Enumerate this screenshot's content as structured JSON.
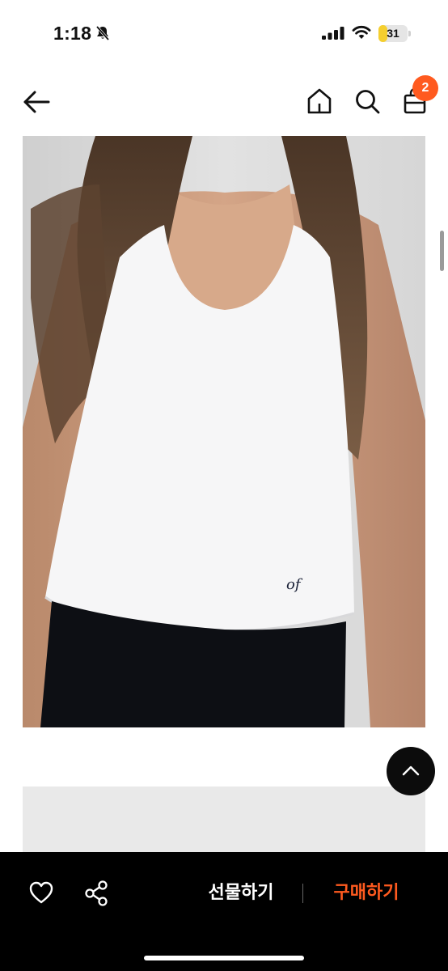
{
  "status_bar": {
    "time": "1:18",
    "battery_level": "31",
    "battery_fraction": 0.31,
    "icons": [
      "bell-slash-icon",
      "cellular-signal-icon",
      "wifi-icon",
      "battery-icon"
    ]
  },
  "header": {
    "icons": [
      "back-arrow-icon",
      "home-icon",
      "search-icon",
      "shopping-bag-icon"
    ],
    "cart_count": "2",
    "badge_color": "#ff5a1f"
  },
  "product_image": {
    "logo_text": "of"
  },
  "floating": {
    "icon": "chevron-up-icon"
  },
  "bottom_bar": {
    "gift_label": "선물하기",
    "buy_label": "구매하기",
    "buy_color": "#ff5a1f",
    "icons": [
      "heart-icon",
      "share-icon"
    ]
  }
}
